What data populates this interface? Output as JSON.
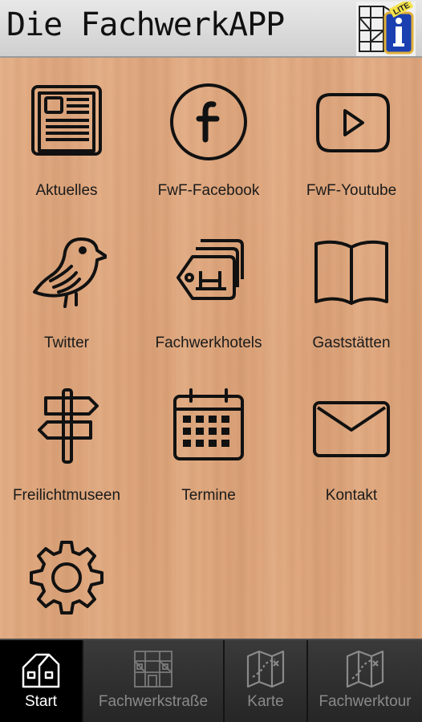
{
  "header": {
    "title": "Die FachwerkAPP",
    "logo_badge": "LITE",
    "logo_icon": "info-i-icon"
  },
  "grid": [
    {
      "label": "Aktuelles",
      "icon": "newspaper-icon"
    },
    {
      "label": "FwF-Facebook",
      "icon": "facebook-icon"
    },
    {
      "label": "FwF-Youtube",
      "icon": "youtube-icon"
    },
    {
      "label": "Twitter",
      "icon": "twitter-bird-icon"
    },
    {
      "label": "Fachwerkhotels",
      "icon": "hotel-tag-icon"
    },
    {
      "label": "Gaststätten",
      "icon": "open-book-icon"
    },
    {
      "label": "Freilichtmuseen",
      "icon": "signpost-icon"
    },
    {
      "label": "Termine",
      "icon": "calendar-icon"
    },
    {
      "label": "Kontakt",
      "icon": "envelope-icon"
    },
    {
      "label": "",
      "icon": "gear-icon"
    }
  ],
  "tabbar": {
    "tabs": [
      {
        "label": "Start",
        "icon": "home-icon",
        "active": true
      },
      {
        "label": "Fachwerkstraße",
        "icon": "timber-frame-house-icon",
        "active": false
      },
      {
        "label": "Karte",
        "icon": "map-icon",
        "active": false
      },
      {
        "label": "Fachwerktour",
        "icon": "tour-map-icon",
        "active": false
      }
    ]
  },
  "colors": {
    "wood": "#e0a97f",
    "header_bg": "#d9d9d9",
    "tabbar_bg": "#2e2e2e",
    "active_tab": "#000000"
  }
}
